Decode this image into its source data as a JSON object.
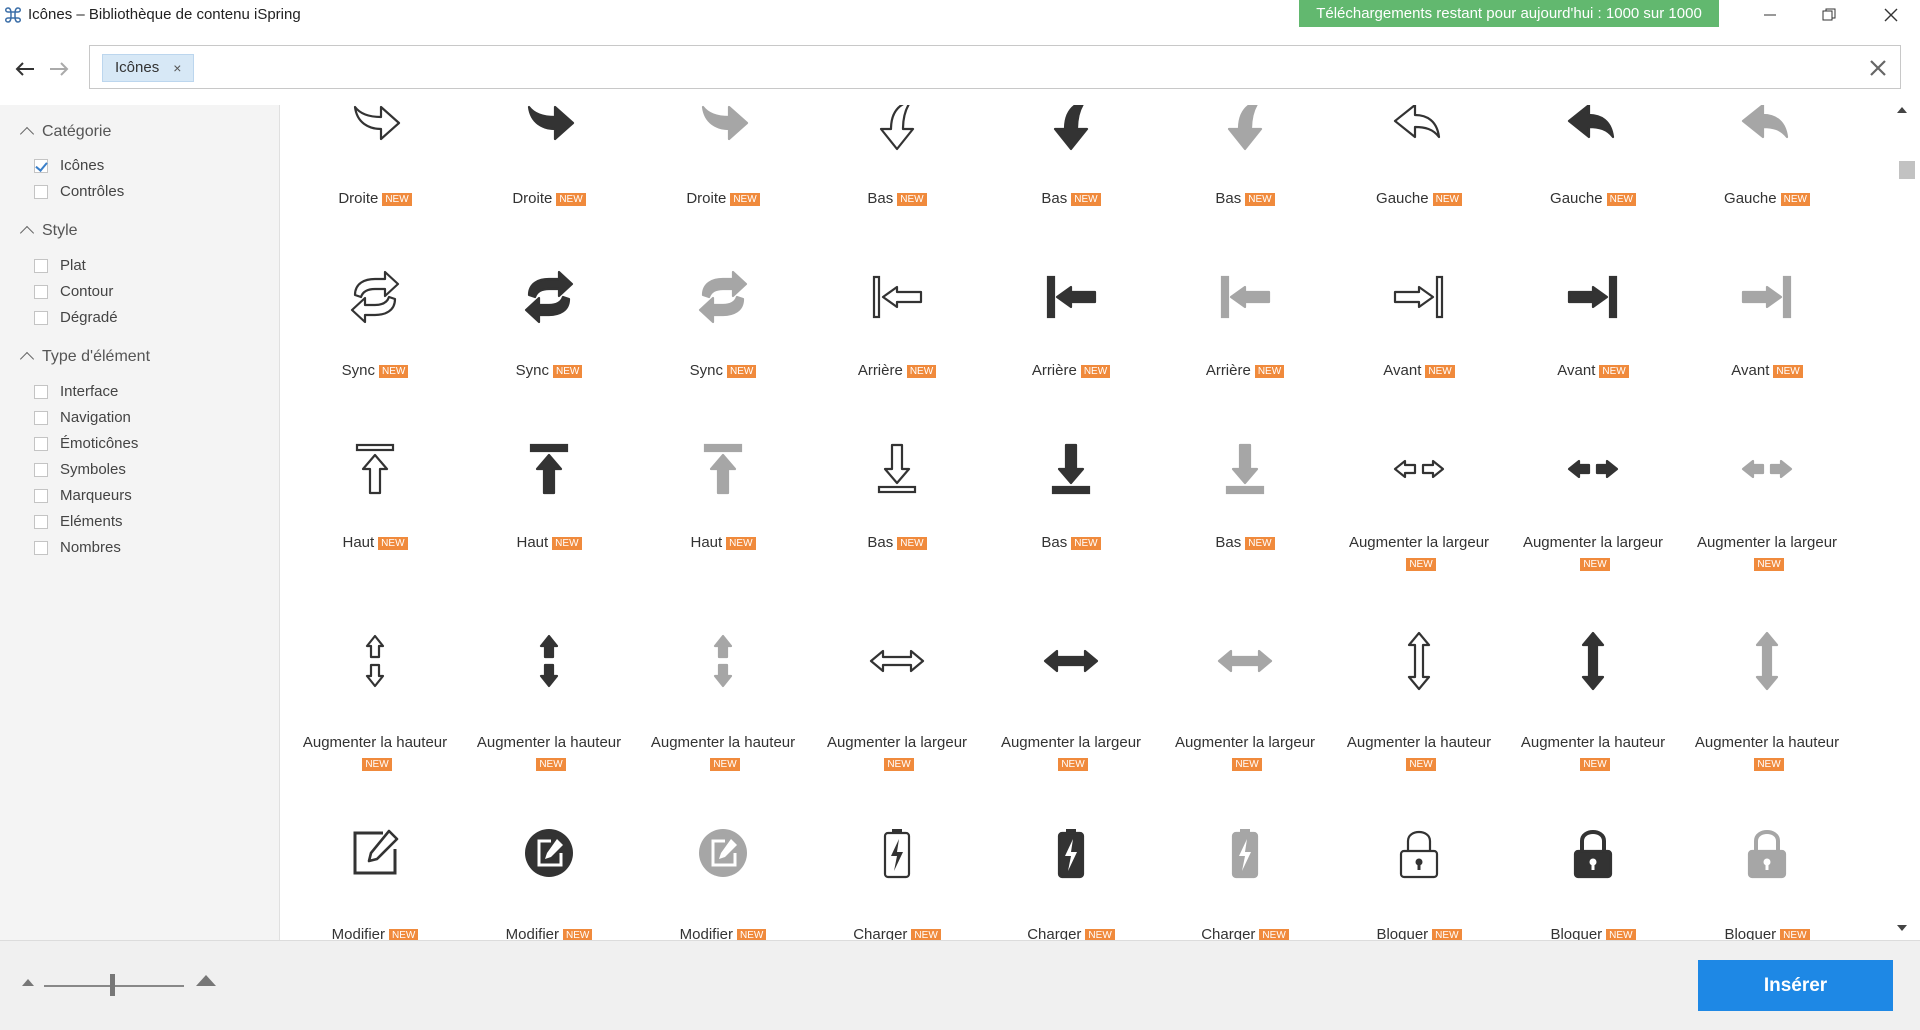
{
  "window": {
    "title": "Icônes – Bibliothèque de contenu iSpring",
    "quota": "Téléchargements restant pour aujourd'hui : 1000 sur 1000"
  },
  "search": {
    "tag": "Icônes",
    "tag_remove": "×"
  },
  "sidebar": {
    "category_title": "Catégorie",
    "category_items": [
      {
        "label": "Icônes",
        "checked": true
      },
      {
        "label": "Contrôles",
        "checked": false
      }
    ],
    "style_title": "Style",
    "style_items": [
      {
        "label": "Plat",
        "checked": false
      },
      {
        "label": "Contour",
        "checked": false
      },
      {
        "label": "Dégradé",
        "checked": false
      }
    ],
    "type_title": "Type d'élément",
    "type_items": [
      {
        "label": "Interface",
        "checked": false
      },
      {
        "label": "Navigation",
        "checked": false
      },
      {
        "label": "Émoticônes",
        "checked": false
      },
      {
        "label": "Symboles",
        "checked": false
      },
      {
        "label": "Marqueurs",
        "checked": false
      },
      {
        "label": "Eléments",
        "checked": false
      },
      {
        "label": "Nombres",
        "checked": false
      }
    ]
  },
  "badge_new": "NEW",
  "icons": [
    [
      {
        "label": "Droite",
        "icon": "curved-arrow-right",
        "style": "outline"
      },
      {
        "label": "Droite",
        "icon": "curved-arrow-right",
        "style": "dark"
      },
      {
        "label": "Droite",
        "icon": "curved-arrow-right",
        "style": "gray"
      },
      {
        "label": "Bas",
        "icon": "curved-arrow-down",
        "style": "outline"
      },
      {
        "label": "Bas",
        "icon": "curved-arrow-down",
        "style": "dark"
      },
      {
        "label": "Bas",
        "icon": "curved-arrow-down",
        "style": "gray"
      },
      {
        "label": "Gauche",
        "icon": "curved-arrow-left",
        "style": "outline"
      },
      {
        "label": "Gauche",
        "icon": "curved-arrow-left",
        "style": "dark"
      },
      {
        "label": "Gauche",
        "icon": "curved-arrow-left",
        "style": "gray"
      }
    ],
    [
      {
        "label": "Sync",
        "icon": "sync",
        "style": "outline"
      },
      {
        "label": "Sync",
        "icon": "sync",
        "style": "dark"
      },
      {
        "label": "Sync",
        "icon": "sync",
        "style": "gray"
      },
      {
        "label": "Arrière",
        "icon": "arrow-to-bar-left",
        "style": "outline"
      },
      {
        "label": "Arrière",
        "icon": "arrow-to-bar-left",
        "style": "dark"
      },
      {
        "label": "Arrière",
        "icon": "arrow-to-bar-left",
        "style": "gray"
      },
      {
        "label": "Avant",
        "icon": "arrow-to-bar-right",
        "style": "outline"
      },
      {
        "label": "Avant",
        "icon": "arrow-to-bar-right",
        "style": "dark"
      },
      {
        "label": "Avant",
        "icon": "arrow-to-bar-right",
        "style": "gray"
      }
    ],
    [
      {
        "label": "Haut",
        "icon": "arrow-up-bar",
        "style": "outline"
      },
      {
        "label": "Haut",
        "icon": "arrow-up-bar",
        "style": "dark"
      },
      {
        "label": "Haut",
        "icon": "arrow-up-bar",
        "style": "gray"
      },
      {
        "label": "Bas",
        "icon": "arrow-down-bar",
        "style": "outline"
      },
      {
        "label": "Bas",
        "icon": "arrow-down-bar",
        "style": "dark"
      },
      {
        "label": "Bas",
        "icon": "arrow-down-bar",
        "style": "gray"
      },
      {
        "label": "Augmenter la largeur",
        "icon": "split-arrows-horizontal",
        "style": "outline"
      },
      {
        "label": "Augmenter la largeur",
        "icon": "split-arrows-horizontal",
        "style": "dark"
      },
      {
        "label": "Augmenter la largeur",
        "icon": "split-arrows-horizontal",
        "style": "gray"
      }
    ],
    [
      {
        "label": "Augmenter la hauteur",
        "icon": "split-arrows-vertical",
        "style": "outline"
      },
      {
        "label": "Augmenter la hauteur",
        "icon": "split-arrows-vertical",
        "style": "dark"
      },
      {
        "label": "Augmenter la hauteur",
        "icon": "split-arrows-vertical",
        "style": "gray"
      },
      {
        "label": "Augmenter la largeur",
        "icon": "double-arrow-horizontal",
        "style": "outline"
      },
      {
        "label": "Augmenter la largeur",
        "icon": "double-arrow-horizontal",
        "style": "dark"
      },
      {
        "label": "Augmenter la largeur",
        "icon": "double-arrow-horizontal",
        "style": "gray"
      },
      {
        "label": "Augmenter la hauteur",
        "icon": "double-arrow-vertical",
        "style": "outline"
      },
      {
        "label": "Augmenter la hauteur",
        "icon": "double-arrow-vertical",
        "style": "dark"
      },
      {
        "label": "Augmenter la hauteur",
        "icon": "double-arrow-vertical",
        "style": "gray"
      }
    ],
    [
      {
        "label": "Modifier",
        "icon": "edit",
        "style": "outline"
      },
      {
        "label": "Modifier",
        "icon": "edit",
        "style": "dark"
      },
      {
        "label": "Modifier",
        "icon": "edit",
        "style": "gray"
      },
      {
        "label": "Charger",
        "icon": "battery-charge",
        "style": "outline"
      },
      {
        "label": "Charger",
        "icon": "battery-charge",
        "style": "dark"
      },
      {
        "label": "Charger",
        "icon": "battery-charge",
        "style": "gray"
      },
      {
        "label": "Bloquer",
        "icon": "lock",
        "style": "outline"
      },
      {
        "label": "Bloquer",
        "icon": "lock",
        "style": "dark"
      },
      {
        "label": "Bloquer",
        "icon": "lock",
        "style": "gray"
      }
    ]
  ],
  "colors": {
    "dark": "#333333",
    "gray": "#a6a6a6",
    "accent": "#1e88e5",
    "new_badge": "#f08a3c",
    "quota_bg": "#62b86f"
  },
  "footer": {
    "insert_label": "Insérer"
  }
}
